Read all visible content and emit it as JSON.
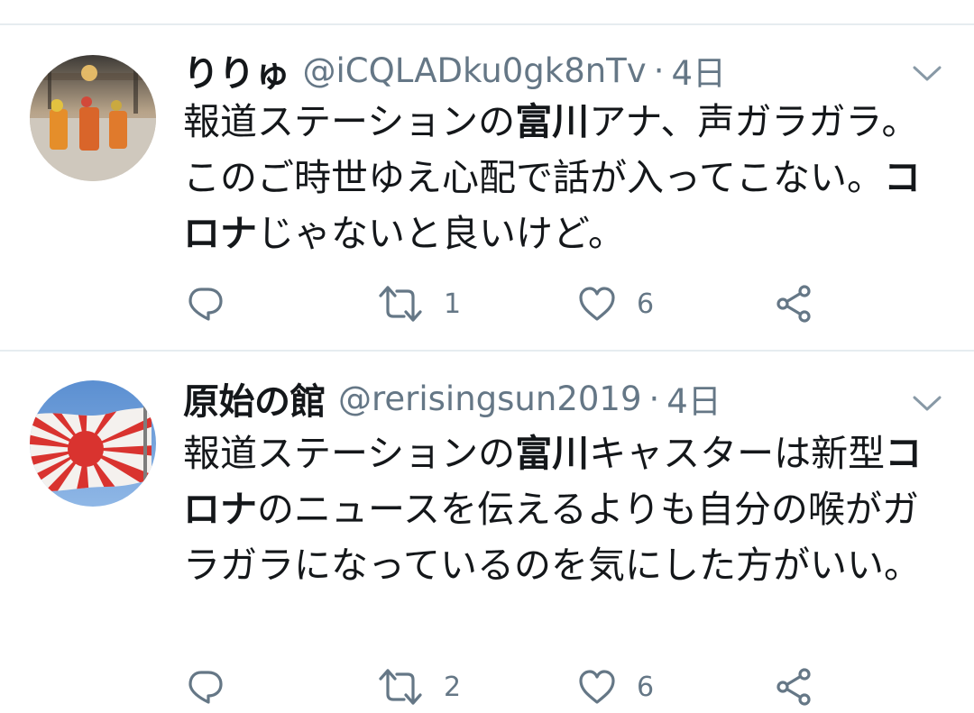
{
  "tweets": [
    {
      "display_name": "りりゅ",
      "handle": "@iCQLADku0gk8nTv",
      "separator": "·",
      "time": "4日",
      "body_parts": [
        {
          "text": "報道ステーションの",
          "bold": false
        },
        {
          "text": "富川",
          "bold": true
        },
        {
          "text": "アナ、声ガラガラ。このご時世ゆえ心配で話が入ってこない。",
          "bold": false
        },
        {
          "text": "コロナ",
          "bold": true
        },
        {
          "text": "じゃないと良いけど。",
          "bold": false
        }
      ],
      "reply_count": "",
      "retweet_count": "1",
      "like_count": "6"
    },
    {
      "display_name": "原始の館",
      "handle": "@rerisingsun2019",
      "separator": "·",
      "time": "4日",
      "body_parts": [
        {
          "text": "報道ステーションの",
          "bold": false
        },
        {
          "text": "富川",
          "bold": true
        },
        {
          "text": "キャスターは新型",
          "bold": false
        },
        {
          "text": "コロナ",
          "bold": true
        },
        {
          "text": "のニュースを伝えるよりも自分の喉がガラガラになっているのを気にした方がいい。",
          "bold": false
        }
      ],
      "reply_count": "",
      "retweet_count": "2",
      "like_count": "6"
    }
  ],
  "icons": {
    "reply": "reply-icon",
    "retweet": "retweet-icon",
    "like": "like-icon",
    "share": "share-icon",
    "menu": "chevron-down-icon"
  },
  "colors": {
    "text": "#14171a",
    "secondary": "#657786",
    "divider": "#e6ecf0",
    "background": "#ffffff"
  }
}
